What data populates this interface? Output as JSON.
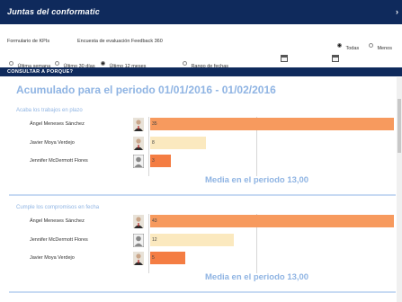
{
  "window": {
    "title": "Juntas del conformatic"
  },
  "filters": {
    "form_label": "Formulario de KPIs",
    "form_value": "Encuesta de evaluación Feedback 360",
    "view_options": [
      {
        "label": "Todas",
        "selected": true
      },
      {
        "label": "Menos",
        "selected": false
      }
    ],
    "period_options": [
      {
        "label": "Última semana",
        "selected": false
      },
      {
        "label": "Último 30 días",
        "selected": false
      },
      {
        "label": "Último 12 meses",
        "selected": true
      },
      {
        "label": "Rango de fechas",
        "selected": false
      }
    ]
  },
  "nav": {
    "label": "CONSULTAR A PORQUE?"
  },
  "main": {
    "title": "Acumulado para el periodo 01/01/2016 - 01/02/2016",
    "sections": [
      {
        "title": "Acaba los trabajos en plazo",
        "rows": [
          {
            "name": "Ángel Meneses Sánchez",
            "value": 35,
            "color": "#f79a5e",
            "avatar": "photo"
          },
          {
            "name": "Javier Moya Verdejo",
            "value": 8,
            "color": "#fbe9bf",
            "avatar": "photo"
          },
          {
            "name": "Jennifer McDermott Flores",
            "value": 3,
            "color": "#f47d43",
            "avatar": "placeholder"
          }
        ],
        "media": "Media en el periodo 13,00"
      },
      {
        "title": "Cumple los compromisos en fecha",
        "rows": [
          {
            "name": "Ángel Meneses Sánchez",
            "value": 43,
            "color": "#f79a5e",
            "avatar": "photo"
          },
          {
            "name": "Jennifer McDermott Flores",
            "value": 12,
            "color": "#fbe9bf",
            "avatar": "placeholder"
          },
          {
            "name": "Javier Moya Verdejo",
            "value": 5,
            "color": "#f47d43",
            "avatar": "photo"
          }
        ],
        "media": "Media en el periodo 13,00"
      }
    ]
  }
}
